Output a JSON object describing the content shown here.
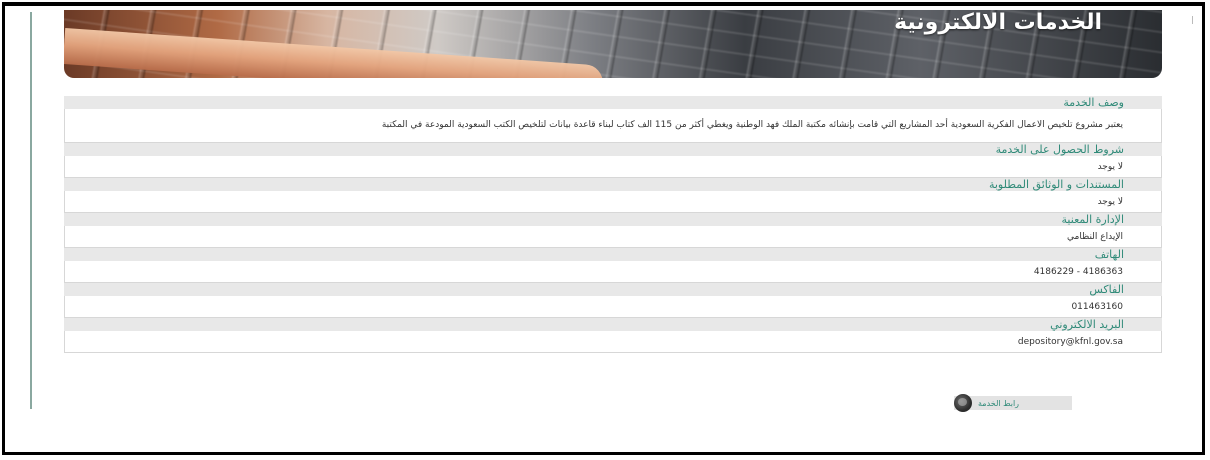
{
  "banner": {
    "title": "الخدمات الالكترونية"
  },
  "sections": [
    {
      "header": "وصف الخدمة",
      "body": "يعتبر مشروع تلخيص الاعمال الفكرية السعودية أحد المشاريع التي قامت بإنشائه مكتبة الملك فهد الوطنية ويغطي أكثر من 115 الف كتاب لبناء قاعدة بيانات لتلخيص الكتب السعودية المودعة في المكتبة"
    },
    {
      "header": "شروط الحصول على الخدمة",
      "body": "لا يوجد"
    },
    {
      "header": "المستندات و الوثائق المطلوبة",
      "body": "لا يوجد"
    },
    {
      "header": "الإدارة المعنية",
      "body": "الإيداع النظامي"
    },
    {
      "header": "الهاتف",
      "body": "4186363 - 4186229"
    },
    {
      "header": "الفاكس",
      "body": "011463160"
    },
    {
      "header": "البريد الالكتروني",
      "body": "depository@kfnl.gov.sa"
    }
  ],
  "service_link": {
    "label": "رابط الخدمة",
    "icon": "globe-icon"
  },
  "colors": {
    "header_text": "#2f8a78",
    "header_bg": "#e8e8e8",
    "body_text": "#333333"
  }
}
